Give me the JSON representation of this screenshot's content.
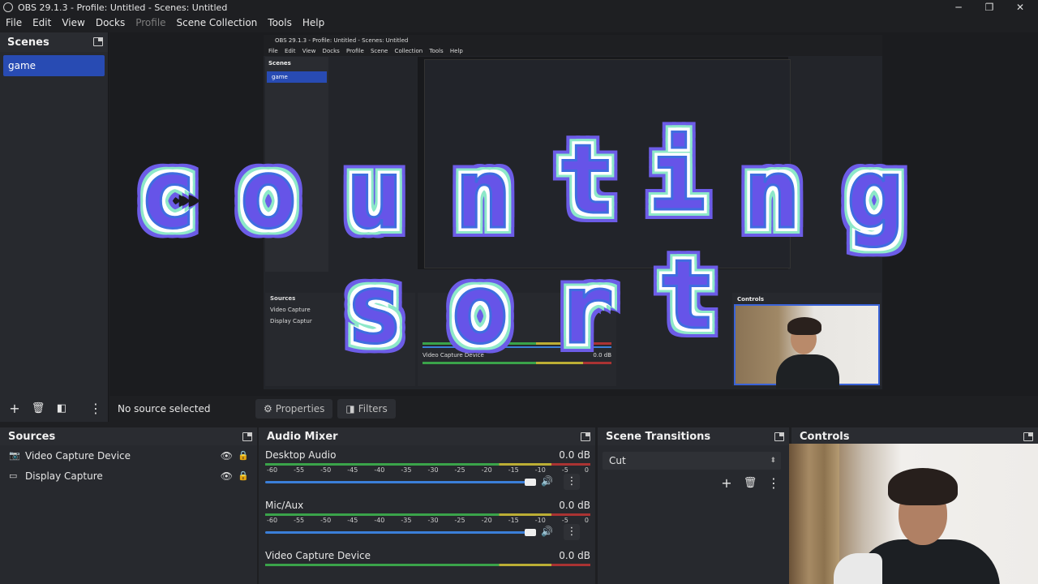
{
  "window": {
    "title": "OBS 29.1.3 - Profile: Untitled - Scenes: Untitled"
  },
  "menu": [
    "File",
    "Edit",
    "View",
    "Docks",
    "Profile",
    "Scene Collection",
    "Tools",
    "Help"
  ],
  "scenes": {
    "title": "Scenes",
    "items": [
      "game"
    ]
  },
  "preview": {
    "nested_title": "OBS 29.1.3 - Profile: Untitled - Scenes: Untitled",
    "nested_menu": "File Edit View Docks Profile Scene Collection Tools Help",
    "nested_scenes_title": "Scenes",
    "nested_scene": "game",
    "nested_sources_title": "Sources",
    "nested_sources": [
      "Video Capture",
      "Display Captur"
    ],
    "nested_controls_title": "Controls",
    "nested_mixer_channel": "Video Capture Device",
    "nested_mixer_db": "0.0 dB",
    "overlay_line1": [
      "c",
      "o",
      "u",
      "n",
      "t",
      "i",
      "n",
      "g"
    ],
    "overlay_line2": [
      "s",
      "o",
      "r",
      "t"
    ]
  },
  "infobar": {
    "no_source": "No source selected",
    "properties": "Properties",
    "filters": "Filters"
  },
  "sources": {
    "title": "Sources",
    "items": [
      {
        "name": "Video Capture Device",
        "icon": "camera-icon"
      },
      {
        "name": "Display Capture",
        "icon": "monitor-icon"
      }
    ]
  },
  "audio_mixer": {
    "title": "Audio Mixer",
    "ticks": [
      "-60",
      "-55",
      "-50",
      "-45",
      "-40",
      "-35",
      "-30",
      "-25",
      "-20",
      "-15",
      "-10",
      "-5",
      "0"
    ],
    "channels": [
      {
        "name": "Desktop Audio",
        "db": "0.0 dB"
      },
      {
        "name": "Mic/Aux",
        "db": "0.0 dB"
      },
      {
        "name": "Video Capture Device",
        "db": "0.0 dB"
      }
    ]
  },
  "scene_transitions": {
    "title": "Scene Transitions",
    "selected": "Cut"
  },
  "controls": {
    "title": "Controls"
  },
  "colors": {
    "accent": "#284bb3",
    "fader": "#3b7fd9",
    "overlay_fill": "#6654e8",
    "overlay_outline": "#8de8c9"
  }
}
